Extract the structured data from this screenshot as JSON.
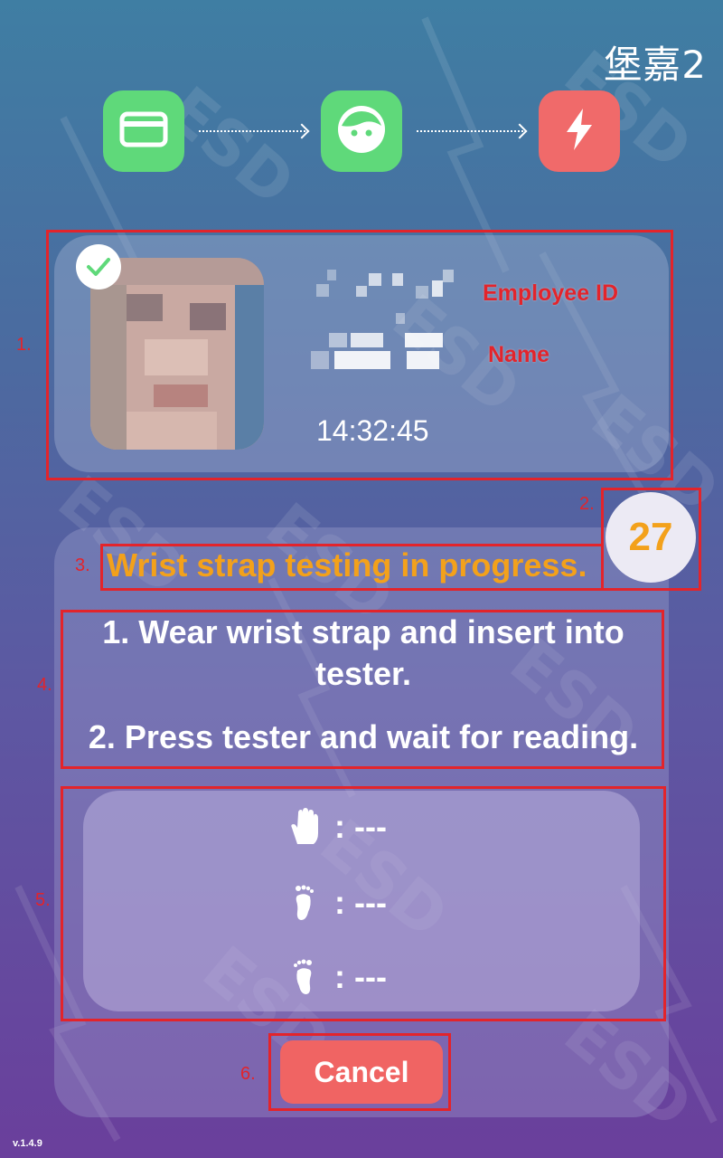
{
  "header": {
    "device_name": "堡嘉2"
  },
  "steps": [
    {
      "name": "card-icon",
      "color": "#5fd97a"
    },
    {
      "name": "face-icon",
      "color": "#5fd97a"
    },
    {
      "name": "lightning-icon",
      "color": "#f06a6a"
    }
  ],
  "employee": {
    "id_label": "Employee ID",
    "name_label": "Name",
    "time": "14:32:45",
    "verified_icon": "check-icon"
  },
  "annotations": {
    "m1": "1.",
    "m2": "2.",
    "m3": "3.",
    "m4": "4.",
    "m5": "5.",
    "m6": "6.",
    "color": "#e3242b"
  },
  "countdown": {
    "value": "27"
  },
  "status": {
    "text": "Wrist strap testing in progress."
  },
  "instructions": {
    "line1": "1. Wear wrist strap and insert into tester.",
    "line2": "2. Press tester and wait for reading."
  },
  "readings": [
    {
      "icon": "hand-icon",
      "value": ": ---"
    },
    {
      "icon": "left-foot-icon",
      "value": ": ---"
    },
    {
      "icon": "right-foot-icon",
      "value": ": ---"
    }
  ],
  "actions": {
    "cancel_label": "Cancel"
  },
  "footer": {
    "version": "v.1.4.9"
  },
  "colors": {
    "accent_orange": "#f3a11b",
    "success_green": "#5fd97a",
    "danger_red": "#f06463"
  }
}
